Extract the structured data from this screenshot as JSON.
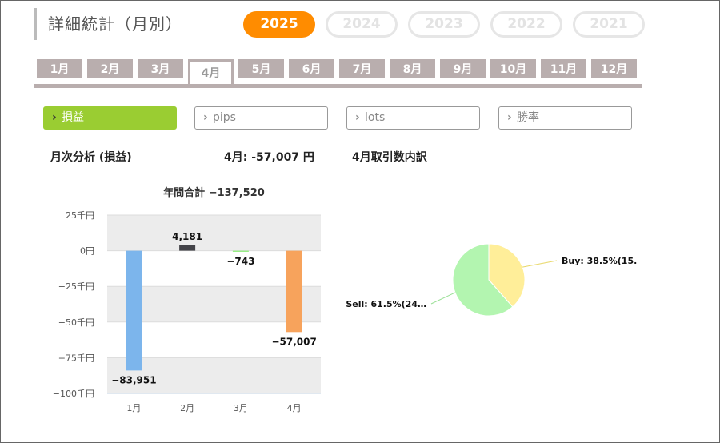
{
  "header": {
    "title": "詳細統計（月別）"
  },
  "years": [
    {
      "label": "2025",
      "active": true
    },
    {
      "label": "2024",
      "active": false
    },
    {
      "label": "2023",
      "active": false
    },
    {
      "label": "2022",
      "active": false
    },
    {
      "label": "2021",
      "active": false
    }
  ],
  "months": [
    {
      "label": "1月",
      "active": false
    },
    {
      "label": "2月",
      "active": false
    },
    {
      "label": "3月",
      "active": false
    },
    {
      "label": "4月",
      "active": true
    },
    {
      "label": "5月",
      "active": false
    },
    {
      "label": "6月",
      "active": false
    },
    {
      "label": "7月",
      "active": false
    },
    {
      "label": "8月",
      "active": false
    },
    {
      "label": "9月",
      "active": false
    },
    {
      "label": "10月",
      "active": false
    },
    {
      "label": "11月",
      "active": false
    },
    {
      "label": "12月",
      "active": false
    }
  ],
  "metrics": [
    {
      "label": "損益",
      "active": true
    },
    {
      "label": "pips",
      "active": false
    },
    {
      "label": "lots",
      "active": false
    },
    {
      "label": "勝率",
      "active": false
    }
  ],
  "icons": {
    "metric_chevron": "chevron-right-icon"
  },
  "colors": {
    "accent_year": "#ff8c00",
    "accent_metric": "#9acd32",
    "month_tab": "#b9aeae"
  },
  "summary": {
    "monthly_label": "月次分析 (損益)",
    "current_month_value": "4月:  -57,007 円",
    "breakdown_label": "4月取引数内訳"
  },
  "chart_data": [
    {
      "type": "bar",
      "title": "年間合計 −137,520",
      "categories": [
        "1月",
        "2月",
        "3月",
        "4月"
      ],
      "values": [
        -83951,
        4181,
        -743,
        -57007
      ],
      "value_labels": [
        "−83,951",
        "4,181",
        "−743",
        "−57,007"
      ],
      "colors": [
        "#7cb5ec",
        "#434348",
        "#90ed7d",
        "#f7a35c"
      ],
      "ylim": [
        -100000,
        25000
      ],
      "yticks": [
        25000,
        0,
        -25000,
        -50000,
        -75000,
        -100000
      ],
      "ytick_labels": [
        "25千円",
        "0円",
        "−25千円",
        "−50千円",
        "−75千円",
        "−100千円"
      ],
      "grid": "alternating-bands",
      "legend": "none"
    },
    {
      "type": "pie",
      "slices": [
        {
          "name": "Buy",
          "value": 38.5,
          "label": "Buy: 38.5%(15.",
          "color": "#ffee99"
        },
        {
          "name": "Sell",
          "value": 61.5,
          "label": "Sell: 61.5%(24…",
          "color": "#b3f5b0"
        }
      ],
      "legend": "none"
    }
  ]
}
